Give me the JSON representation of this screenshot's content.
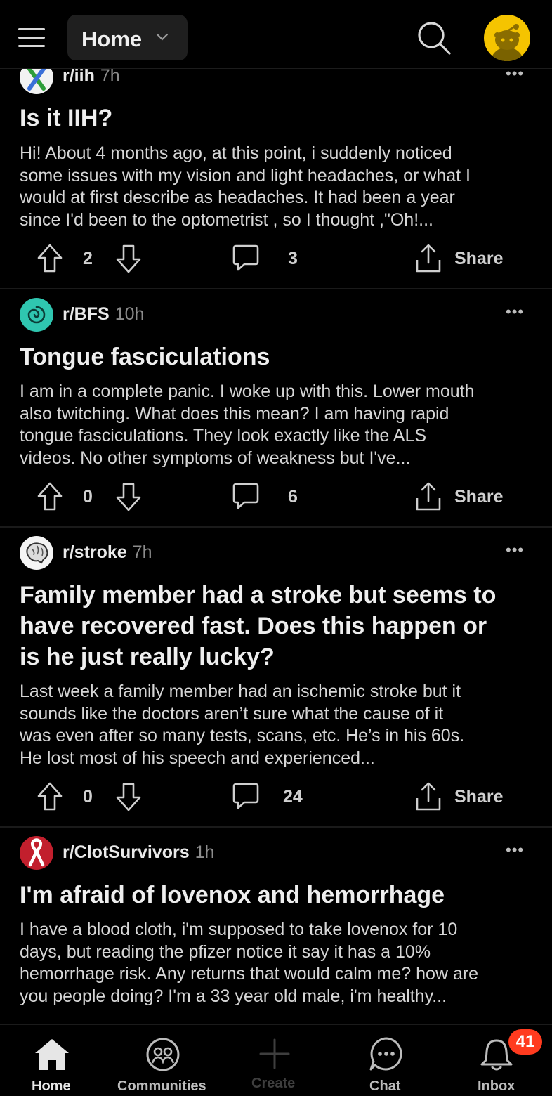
{
  "header": {
    "feed_label": "Home"
  },
  "posts": [
    {
      "subreddit": "r/iih",
      "time": "7h",
      "title": "Is it IIH?",
      "body_lines": [
        "Hi! About 4 months ago, at this point, i suddenly noticed",
        "some issues with my vision and light headaches, or what I",
        "would at first describe as headaches. It had been a year",
        "since I'd been to the optometrist  , so I thought ,\"Oh!..."
      ],
      "votes": "2",
      "comments": "3",
      "share_label": "Share"
    },
    {
      "subreddit": "r/BFS",
      "time": "10h",
      "title": "Tongue fasciculations",
      "body_lines": [
        "I am in a complete panic. I woke up with this. Lower mouth",
        "also twitching. What does this mean? I am having rapid",
        "tongue fasciculations. They look exactly like the ALS",
        "videos. No other symptoms of weakness but I've..."
      ],
      "votes": "0",
      "comments": "6",
      "share_label": "Share"
    },
    {
      "subreddit": "r/stroke",
      "time": "7h",
      "title_lines": [
        "Family member had a stroke but seems to",
        "have recovered fast. Does this happen or",
        "is he just really lucky?"
      ],
      "body_lines": [
        "Last week a family member had an ischemic stroke but it",
        "sounds like the doctors aren’t sure what the cause of it",
        "was even after so many tests, scans, etc. He’s in his 60s.",
        "He lost most of his speech and experienced..."
      ],
      "votes": "0",
      "comments": "24",
      "share_label": "Share"
    },
    {
      "subreddit": "r/ClotSurvivors",
      "time": "1h",
      "title": "I'm afraid of lovenox and hemorrhage",
      "body_lines": [
        "I have a blood cloth, i'm supposed to take lovenox for 10",
        "days, but reading the pfizer notice it say it has a 10%",
        "hemorrhage risk. Any returns that would calm me? how are",
        "you people doing? I'm a 33 year old male, i'm healthy..."
      ]
    }
  ],
  "tabbar": {
    "home": "Home",
    "communities": "Communities",
    "create": "Create",
    "chat": "Chat",
    "inbox": "Inbox",
    "inbox_badge": "41"
  },
  "colors": {
    "background": "#000000",
    "avatar": "#f5c400",
    "bfs_icon": "#2fc6b0",
    "clot_icon": "#c21f2d",
    "badge": "#ff3b1f"
  }
}
